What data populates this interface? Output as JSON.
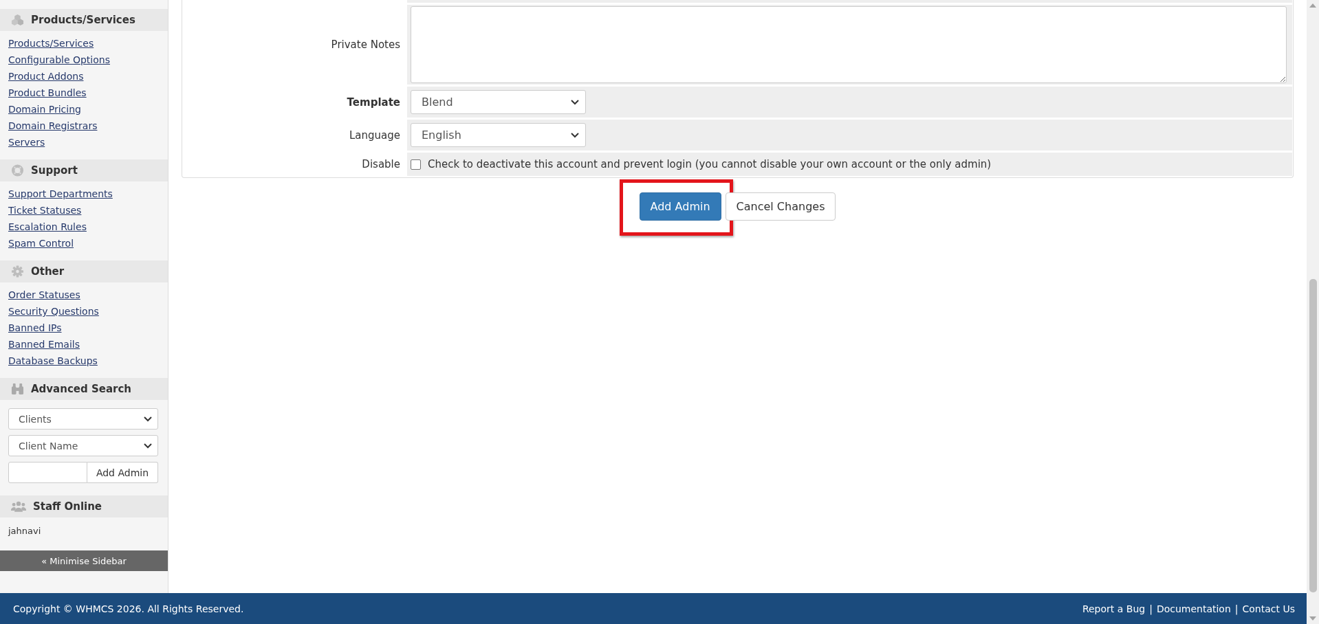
{
  "sidebar": {
    "sections": [
      {
        "kind": "links",
        "title": "Products/Services",
        "links": [
          "Products/Services",
          "Configurable Options",
          "Product Addons",
          "Product Bundles",
          "Domain Pricing",
          "Domain Registrars",
          "Servers"
        ]
      },
      {
        "kind": "links",
        "title": "Support",
        "links": [
          "Support Departments",
          "Ticket Statuses",
          "Escalation Rules",
          "Spam Control"
        ]
      },
      {
        "kind": "links",
        "title": "Other",
        "links": [
          "Order Statuses",
          "Security Questions",
          "Banned IPs",
          "Banned Emails",
          "Database Backups"
        ]
      },
      {
        "kind": "search",
        "title": "Advanced Search",
        "selects": [
          "Clients",
          "Client Name"
        ],
        "button": "Add Admin"
      },
      {
        "kind": "staff",
        "title": "Staff Online",
        "users": [
          "jahnavi"
        ]
      }
    ],
    "minimise": "« Minimise Sidebar"
  },
  "form": {
    "rows": [
      {
        "kind": "textarea",
        "label": "Private Notes",
        "bold": false
      },
      {
        "kind": "select",
        "label": "Template",
        "bold": true,
        "value": "Blend"
      },
      {
        "kind": "select",
        "label": "Language",
        "bold": false,
        "value": "English"
      },
      {
        "kind": "checkbox",
        "label": "Disable",
        "bold": false,
        "checked": false,
        "text": "Check to deactivate this account and prevent login (you cannot disable your own account or the only admin)"
      }
    ]
  },
  "buttons": [
    {
      "kind": "primary",
      "label": "Add Admin",
      "highlighted": true
    },
    {
      "kind": "default",
      "label": "Cancel Changes",
      "highlighted": false
    }
  ],
  "footer": {
    "copyright": "Copyright © WHMCS 2026. All Rights Reserved.",
    "links": [
      "Report a Bug",
      "Documentation",
      "Contact Us"
    ],
    "separators": [
      "|",
      "|"
    ]
  }
}
